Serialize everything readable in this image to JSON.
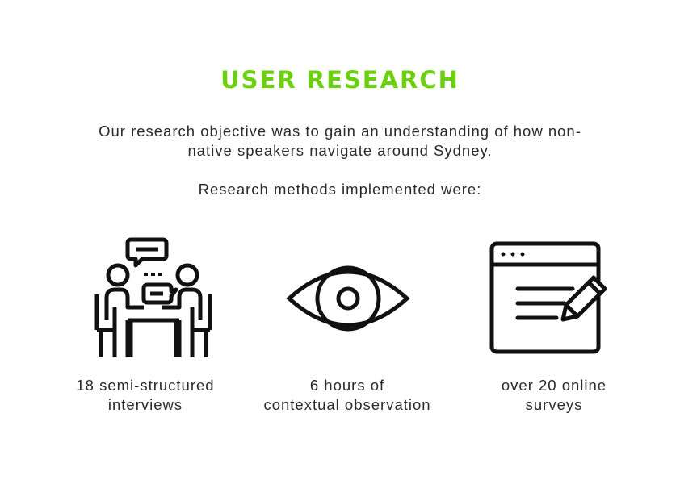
{
  "title": "USER RESEARCH",
  "intro": {
    "line1": "Our research objective was to gain an understanding of how non-",
    "line2": "native speakers navigate around Sydney."
  },
  "methods_label": "Research methods implemented were:",
  "methods": [
    {
      "icon": "interview-icon",
      "line1": "18 semi-structured",
      "line2": "interviews"
    },
    {
      "icon": "eye-icon",
      "line1": "6 hours of",
      "line2": "contextual observation"
    },
    {
      "icon": "survey-icon",
      "line1": "over 20 online",
      "line2": "surveys"
    }
  ],
  "colors": {
    "accent": "#6ccf0f",
    "text": "#2a2a2a",
    "icon": "#111111"
  }
}
